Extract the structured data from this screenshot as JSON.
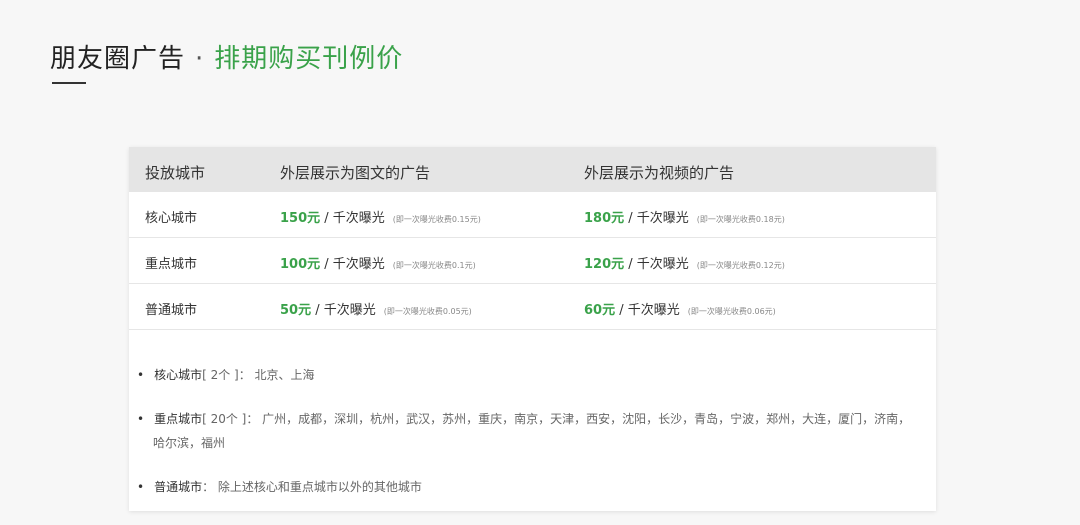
{
  "header": {
    "title_main": "朋友圈广告",
    "separator": "·",
    "title_highlight": "排期购买刊例价"
  },
  "table": {
    "headers": [
      "投放城市",
      "外层展示为图文的广告",
      "外层展示为视频的广告"
    ],
    "rows": [
      {
        "city": "核心城市",
        "image_price": "150元",
        "image_unit": "/ 千次曝光",
        "image_note": "(即一次曝光收费0.15元)",
        "video_price": "180元",
        "video_unit": "/ 千次曝光",
        "video_note": "(即一次曝光收费0.18元)"
      },
      {
        "city": "重点城市",
        "image_price": "100元",
        "image_unit": "/ 千次曝光",
        "image_note": "(即一次曝光收费0.1元)",
        "video_price": "120元",
        "video_unit": "/ 千次曝光",
        "video_note": "(即一次曝光收费0.12元)"
      },
      {
        "city": "普通城市",
        "image_price": "50元",
        "image_unit": "/ 千次曝光",
        "image_note": "(即一次曝光收费0.05元)",
        "video_price": "60元",
        "video_unit": "/ 千次曝光",
        "video_note": "(即一次曝光收费0.06元)"
      }
    ]
  },
  "notes": {
    "bullet": "•",
    "core": {
      "label": "核心城市",
      "count": "[ 2个 ]",
      "text": "：  北京、上海"
    },
    "key": {
      "label": "重点城市",
      "count": "[ 20个 ]",
      "text": "：  广州，成都，深圳，杭州，武汉，苏州，重庆，南京，天津，西安，沈阳，长沙，青岛，宁波，郑州，大连，厦门，济南，",
      "text_cont": "哈尔滨，福州"
    },
    "normal": {
      "label": "普通城市",
      "text": "：  除上述核心和重点城市以外的其他城市"
    }
  }
}
